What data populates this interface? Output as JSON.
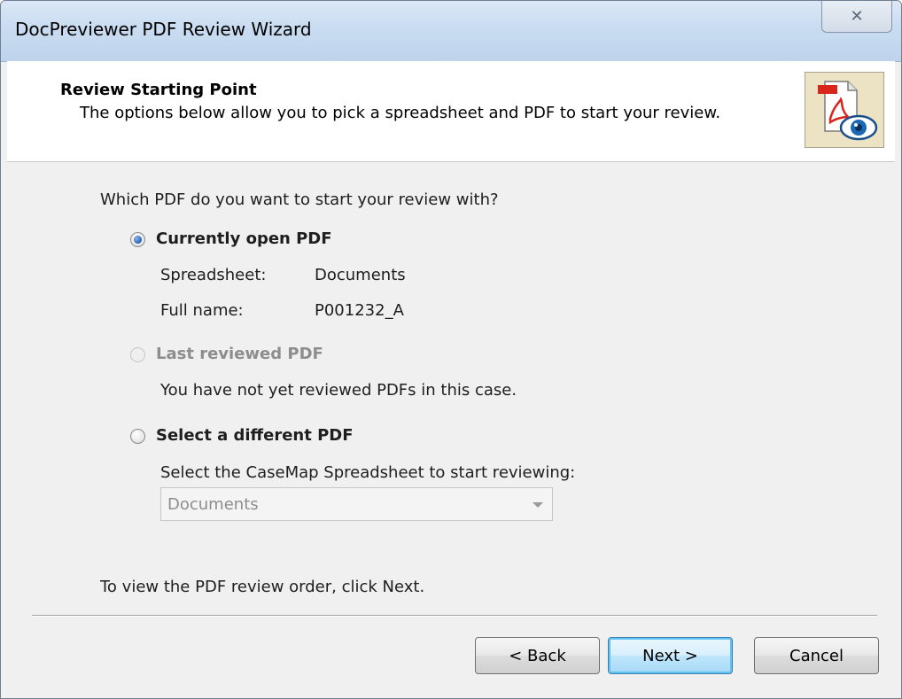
{
  "window": {
    "title": "DocPreviewer PDF Review Wizard",
    "close_glyph": "✕"
  },
  "header": {
    "title": "Review Starting Point",
    "subtitle": "The options below allow you to pick a spreadsheet and PDF to start your review.",
    "icon": "pdf-review-eye-icon"
  },
  "body": {
    "question": "Which PDF do you want to start your review with?",
    "options": [
      {
        "label": "Currently open PDF",
        "checked": true,
        "enabled": true,
        "details": [
          {
            "key": "Spreadsheet:",
            "value": "Documents"
          },
          {
            "key": "Full name:",
            "value": "P001232_A"
          }
        ]
      },
      {
        "label": "Last reviewed PDF",
        "checked": false,
        "enabled": false,
        "note": "You have not yet reviewed PDFs in this case."
      },
      {
        "label": "Select a different PDF",
        "checked": false,
        "enabled": true,
        "select_label": "Select the CaseMap Spreadsheet to start reviewing:",
        "select_value": "Documents"
      }
    ],
    "footer_text": "To view the PDF review order, click Next."
  },
  "buttons": {
    "back": "< Back",
    "next": "Next >",
    "cancel": "Cancel"
  },
  "colors": {
    "titlebar": "#c9dcf1",
    "accent": "#1f5fb4",
    "pdf_red": "#d8261c",
    "eye_blue": "#1d68b3"
  }
}
